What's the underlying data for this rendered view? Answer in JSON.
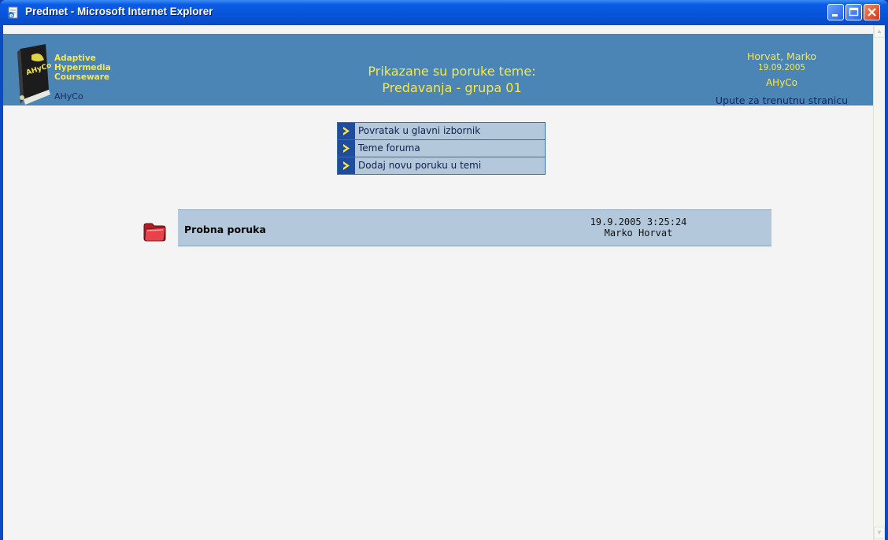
{
  "window": {
    "title": "Predmet - Microsoft Internet Explorer"
  },
  "logo": {
    "lines": [
      "Adaptive",
      "Hypermedia",
      "Courseware"
    ],
    "short": "AHyCo",
    "book_label": "AHyCo"
  },
  "header": {
    "title_line1": "Prikazane su poruke teme:",
    "title_line2": "Predavanja - grupa 01",
    "user": "Horvat, Marko",
    "date": "19.09.2005",
    "app": "AHyCo",
    "help": "Upute za trenutnu stranicu"
  },
  "menu": {
    "items": [
      {
        "label": "Povratak u glavni izbornik"
      },
      {
        "label": "Teme foruma"
      },
      {
        "label": "Dodaj novu poruku u temi"
      }
    ]
  },
  "messages": [
    {
      "title": "Probna poruka",
      "datetime": "19.9.2005 3:25:24",
      "author": "Marko Horvat"
    }
  ],
  "colors": {
    "header_bg": "#4a85b5",
    "accent_yellow": "#f6e84e",
    "row_bg": "#b4c8dc",
    "page_bg": "#f4f4f4"
  }
}
